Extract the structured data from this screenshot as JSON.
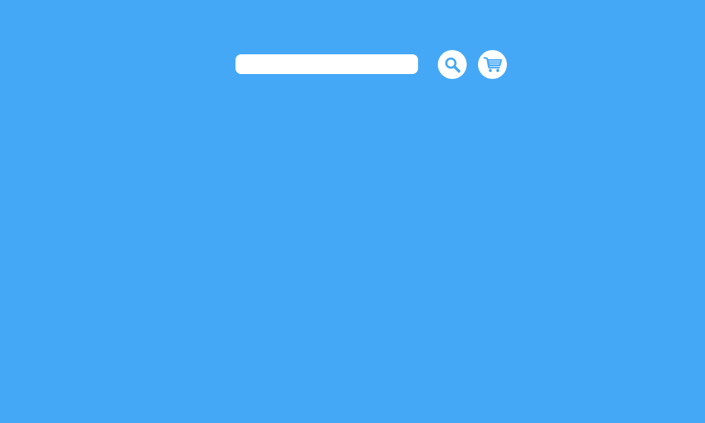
{
  "search": {
    "value": "",
    "placeholder": ""
  },
  "buttons": {
    "search_icon": "search-icon",
    "cart_icon": "shopping-cart-icon"
  },
  "colors": {
    "background": "#44a8f7",
    "icon": "#44a8f7",
    "surface": "#ffffff"
  }
}
